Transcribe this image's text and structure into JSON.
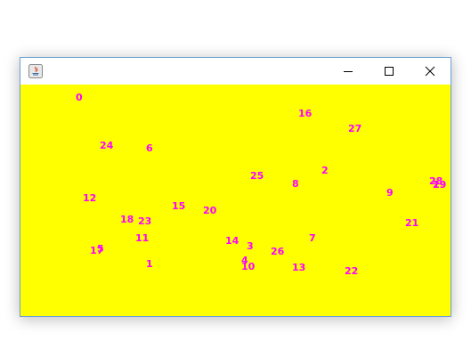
{
  "window": {
    "controls": {
      "minimize_icon": "minimize-icon",
      "maximize_icon": "maximize-icon",
      "close_icon": "close-icon"
    }
  },
  "canvas": {
    "background_color": "#ffff00",
    "label_color": "#ff00ff",
    "labels": [
      "0",
      "1",
      "2",
      "3",
      "4",
      "5",
      "6",
      "7",
      "8",
      "9",
      "10",
      "11",
      "12",
      "13",
      "14",
      "15",
      "16",
      "17",
      "18",
      "19",
      "20",
      "21",
      "22",
      "23",
      "24",
      "25",
      "26",
      "27",
      "28",
      "29"
    ]
  }
}
